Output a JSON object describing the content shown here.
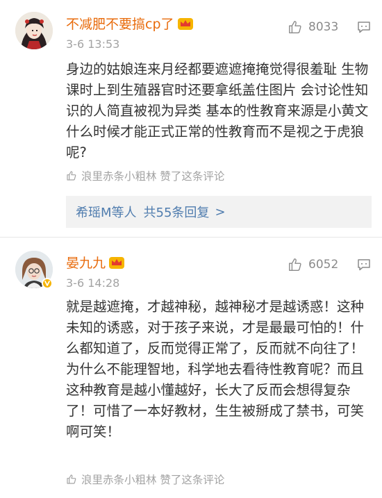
{
  "comments": [
    {
      "username": "不减肥不要搞cp了",
      "time": "3-6 13:53",
      "likes": "8033",
      "text": "身边的姑娘连来月经都要遮遮掩掩觉得很羞耻 生物课时上到生殖器官时还要拿纸盖住图片 会讨论性知识的人简直被视为异类 基本的性教育来源是小黄文 什么时候才能正式正常的性教育而不是视之于虎狼呢?",
      "liked_by": "浪里赤条小粗林 赞了这条评论",
      "replies": {
        "who": "希瑶M等人",
        "count_label": "共55条回复",
        "arrow": ">"
      }
    },
    {
      "username": "晏九九",
      "time": "3-6 14:28",
      "likes": "6052",
      "text": "就是越遮掩，才越神秘，越神秘才是越诱惑！这种未知的诱惑，对于孩子来说，才是最最可怕的！什么都知道了，反而觉得正常了，反而就不向往了！为什么不能理智地，科学地去看待性教育呢？而且这种教育是越小懂越好，长大了反而会想得复杂了！可惜了一本好教材，生生被掰成了禁书，可笑啊可笑！",
      "liked_by": "浪里赤条小粗林 赞了这条评论"
    }
  ],
  "colors": {
    "username": "#e86b0c",
    "meta": "#a3a3a3",
    "link": "#4f7cae",
    "reply_bg": "#f2f2f2",
    "badge": "#f6b400"
  },
  "icons": [
    "thumb-up-icon",
    "reply-icon",
    "crown-icon",
    "verified-badge-icon"
  ]
}
